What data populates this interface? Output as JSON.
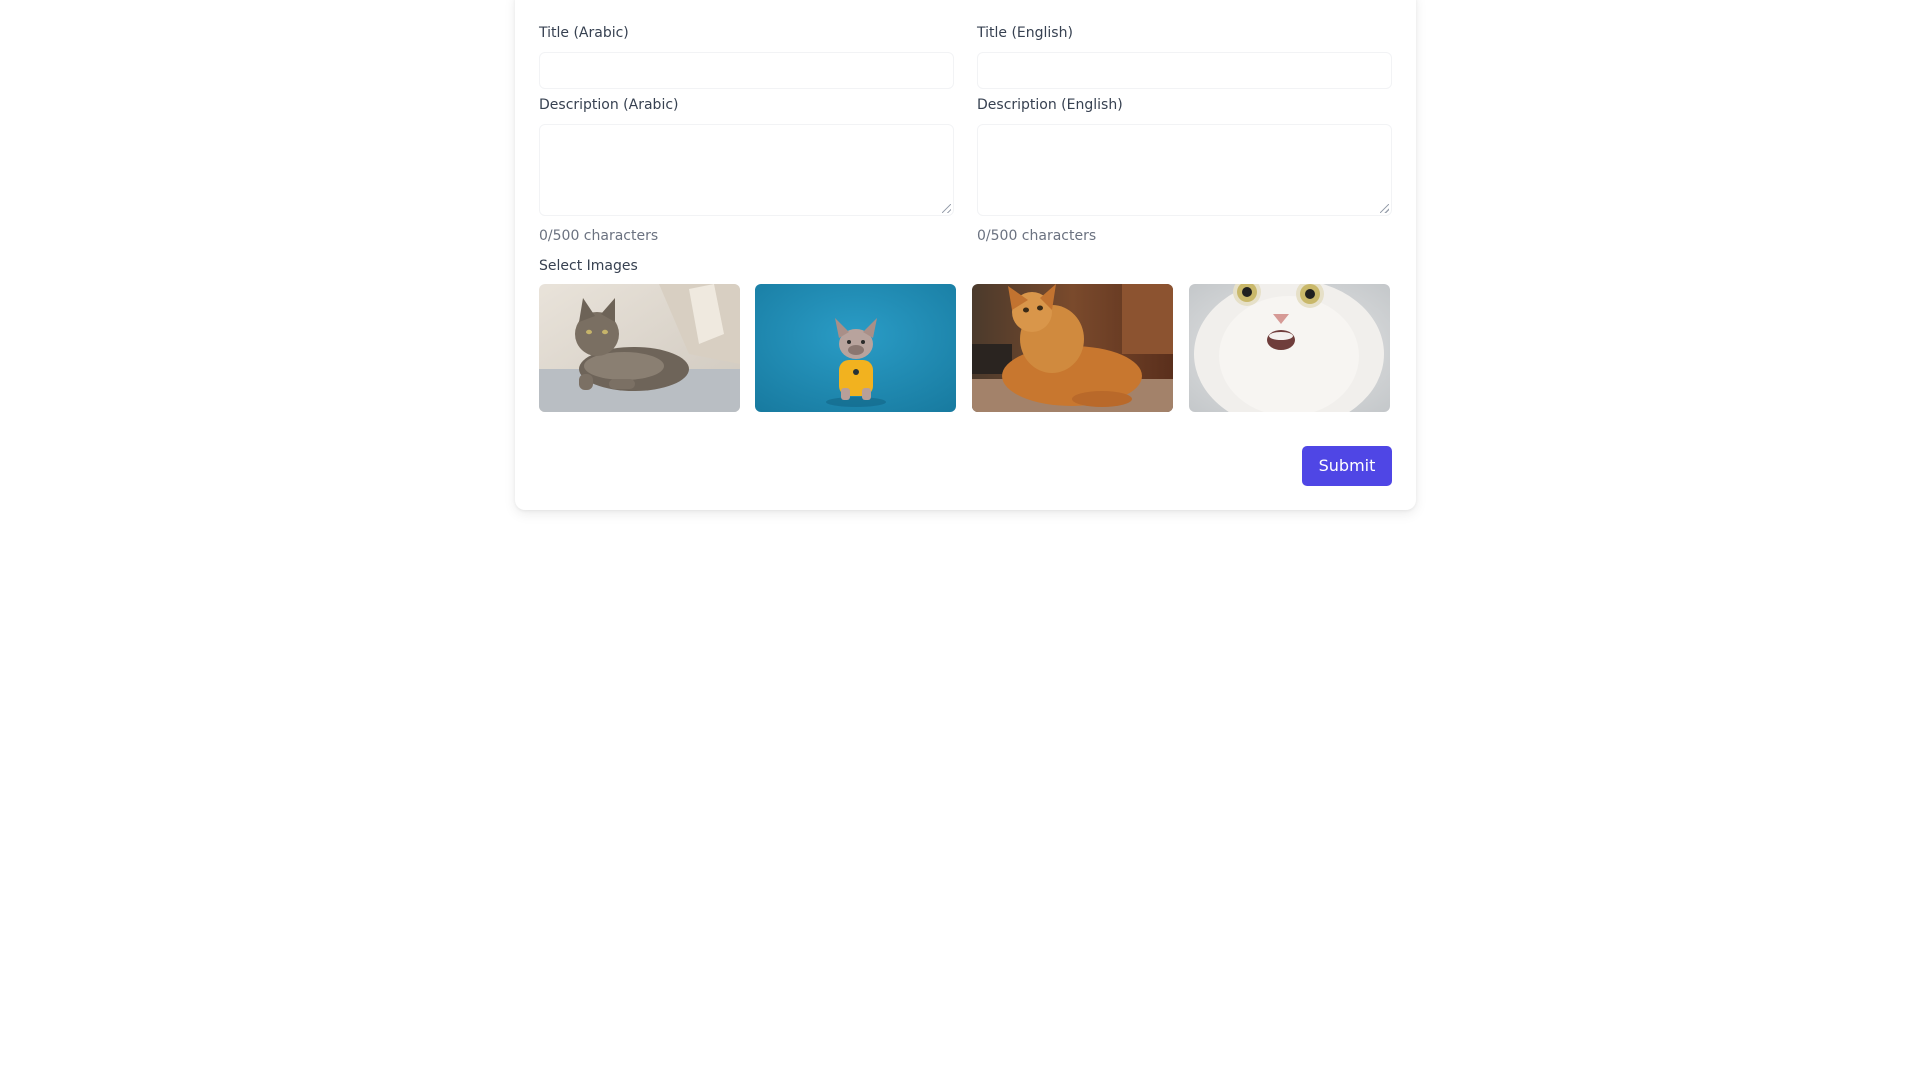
{
  "form": {
    "title_ar": {
      "label": "Title (Arabic)",
      "value": ""
    },
    "title_en": {
      "label": "Title (English)",
      "value": ""
    },
    "desc_ar": {
      "label": "Description (Arabic)",
      "value": "",
      "counter": "0/500 characters"
    },
    "desc_en": {
      "label": "Description (English)",
      "value": "",
      "counter": "0/500 characters"
    },
    "images_label": "Select Images",
    "images": [
      {
        "subject": "tabby cat lying on a sofa"
      },
      {
        "subject": "french bulldog in yellow shirt on blue background"
      },
      {
        "subject": "orange long-haired cat looking up"
      },
      {
        "subject": "white cat with surprised face"
      }
    ],
    "submit_label": "Submit"
  },
  "colors": {
    "accent": "#4f46e5",
    "label": "#374151",
    "muted": "#6b7280"
  }
}
